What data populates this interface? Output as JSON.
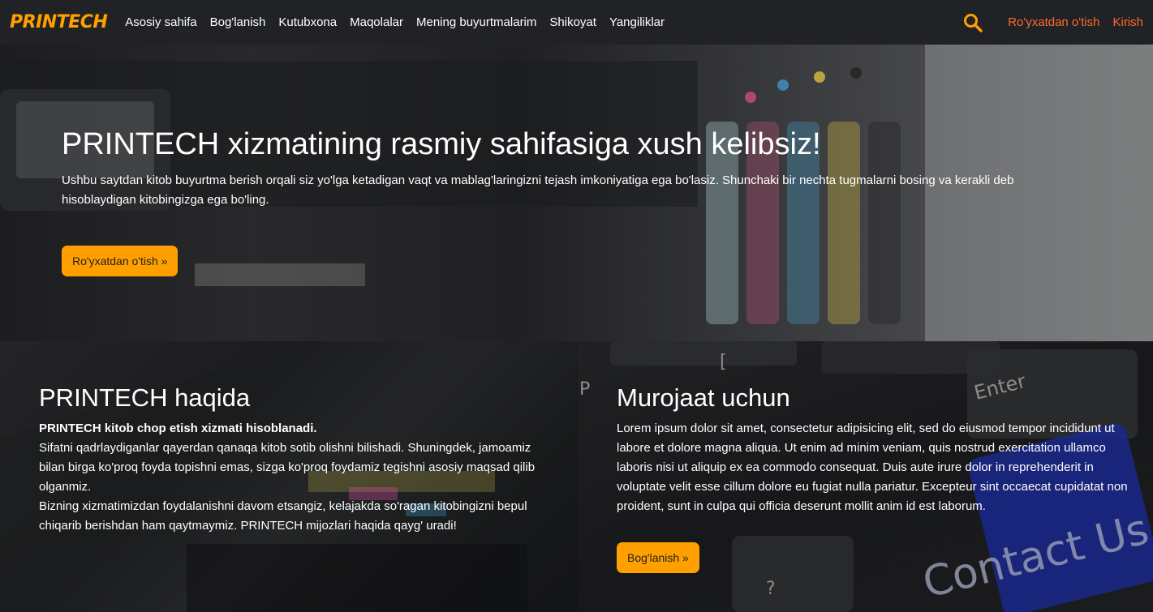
{
  "nav": {
    "brand": "PRINTECH",
    "links": [
      "Asosiy sahifa",
      "Bog'lanish",
      "Kutubxona",
      "Maqolalar",
      "Mening buyurtmalarim",
      "Shikoyat",
      "Yangiliklar"
    ],
    "register": "Ro'yxatdan o'tish",
    "login": "Kirish",
    "search_icon": "search-icon"
  },
  "hero": {
    "title": "PRINTECH xizmatining rasmiy sahifasiga xush kelibsiz!",
    "text": "Ushbu saytdan kitob buyurtma berish orqali siz yo'lga ketadigan vaqt va mablag'laringizni tejash imkoniyatiga ega bo'lasiz. Shunchaki bir nechta tugmalarni bosing va kerakli deb hisoblaydigan kitobingizga ega bo'ling.",
    "button": "Ro'yxatdan o'tish »"
  },
  "about": {
    "title": "PRINTECH haqida",
    "lead": "PRINTECH kitob chop etish xizmati hisoblanadi.",
    "text1": "Sifatni qadrlaydiganlar qayerdan qanaqa kitob sotib olishni bilishadi. Shuningdek, jamoamiz bilan birga ko'proq foyda topishni emas, sizga ko'proq foydamiz tegishni asosiy maqsad qilib olganmiz.",
    "text2": "Bizning xizmatimizdan foydalanishni davom etsangiz, kelajakda so'ragan kitobingizni bepul chiqarib berishdan ham qaytmaymiz. PRINTECH mijozlari haqida qayg' uradi!"
  },
  "contact": {
    "title": "Murojaat uchun",
    "text": "Lorem ipsum dolor sit amet, consectetur adipisicing elit, sed do eiusmod tempor incididunt ut labore et dolore magna aliqua. Ut enim ad minim veniam, quis nostrud exercitation ullamco laboris nisi ut aliquip ex ea commodo consequat. Duis aute irure dolor in reprehenderit in voluptate velit esse cillum dolore eu fugiat nulla pariatur. Excepteur sint occaecat cupidatat non proident, sunt in culpa qui officia deserunt mollit anim id est laborum.",
    "button": "Bog'lanish »",
    "image_text": {
      "key_enter": "Enter",
      "key_p": "P",
      "key_bracket": "[",
      "key_question": "?",
      "contact_key": "Contact Us"
    }
  },
  "colors": {
    "accent": "#ffa000",
    "auth_link": "#ff6a2a",
    "navbar": "#202226"
  }
}
